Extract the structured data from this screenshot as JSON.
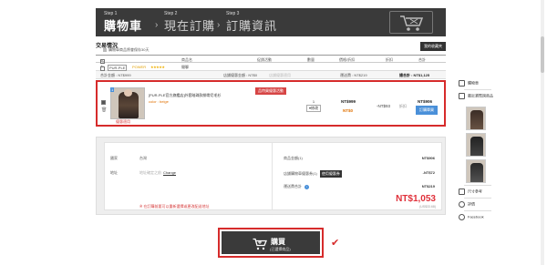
{
  "steps": [
    {
      "num": "Step 1",
      "label": "購物車"
    },
    {
      "num": "Step 2",
      "label": "現在訂購"
    },
    {
      "num": "Step 3",
      "label": "訂購資訊"
    }
  ],
  "section": {
    "title": "交易情況",
    "note": "購物車商品將會保存30天",
    "fav_button": "我的收藏夾"
  },
  "columns": {
    "select_all": "所有",
    "product": "商品名",
    "promo": "促銷活動",
    "qty": "數量",
    "price_discount": "價格/折扣",
    "discount": "折扣",
    "total": "合計"
  },
  "shop_row": {
    "shop_name": "PUR-PLE",
    "power": "POWER",
    "stars": "★★★★★",
    "status": "閒聊"
  },
  "subtotal_row": {
    "sum_label": "合計金額 : NT$999",
    "promo_label": "店鋪優惠金額 : NT$0",
    "apply_label": "店鋪優惠適用",
    "shipping_label": "運送費 : NT$219",
    "total_label": "總合計 : NT$1,125"
  },
  "product": {
    "badge": "1",
    "name": "[PUR-PLE官方旗艦店]外套暗珠款綁帶尼毛衫",
    "color": "color : beige",
    "view_link": "優惠適用",
    "promo_tag": "品特買優惠活動",
    "qty": "1",
    "edit": "修改",
    "price": "NT$999",
    "disc_price": "NT$0",
    "off": "-NT$93",
    "off2": "折扣",
    "total": "NT$906",
    "checkout_one": "訂購單買"
  },
  "address": {
    "country_label": "國家",
    "country": "台灣",
    "addr_label": "地址",
    "addr_value": "地址確定之前",
    "change": "Change",
    "warning": "※ 在訂購前要可以重新選擇或更改配送地址"
  },
  "totals": {
    "amount_label": "商品金額(1)",
    "amount": "NT$906",
    "coupon_label": "店鋪購物車優惠券(1)",
    "coupon_btn": "使用優惠券",
    "coupon_value": "-NT$72",
    "shipping_label": "運送費合計",
    "shipping_info": "i",
    "shipping": "NT$219",
    "grand_total": "NT$1,053",
    "grand_sub": "(US$33.68)"
  },
  "buy_button": {
    "label": "購買",
    "sub": "(已選擇商品)"
  },
  "sidebar": {
    "items": [
      {
        "label": "購物車"
      },
      {
        "label": "最近瀏覽過商品"
      },
      {
        "label": "尺寸參考"
      },
      {
        "label": "評價"
      },
      {
        "label": "Facebook"
      }
    ]
  },
  "colors": {
    "accent_red": "#d62b2b",
    "dark": "#3a3a3a",
    "blue": "#4a90d9",
    "price_red": "#e0303a"
  }
}
